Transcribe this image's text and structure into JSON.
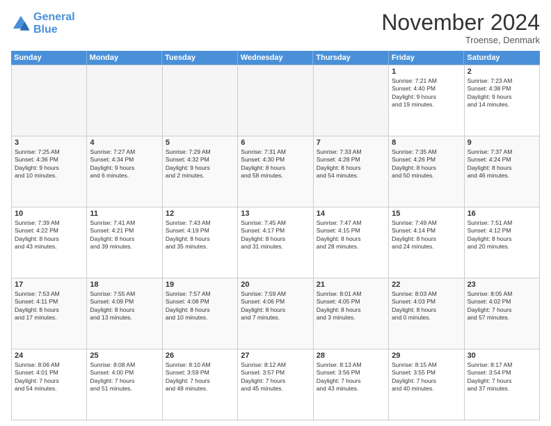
{
  "logo": {
    "line1": "General",
    "line2": "Blue"
  },
  "title": "November 2024",
  "location": "Troense, Denmark",
  "header": {
    "days": [
      "Sunday",
      "Monday",
      "Tuesday",
      "Wednesday",
      "Thursday",
      "Friday",
      "Saturday"
    ]
  },
  "weeks": [
    [
      {
        "day": "",
        "info": ""
      },
      {
        "day": "",
        "info": ""
      },
      {
        "day": "",
        "info": ""
      },
      {
        "day": "",
        "info": ""
      },
      {
        "day": "",
        "info": ""
      },
      {
        "day": "1",
        "info": "Sunrise: 7:21 AM\nSunset: 4:40 PM\nDaylight: 9 hours\nand 19 minutes."
      },
      {
        "day": "2",
        "info": "Sunrise: 7:23 AM\nSunset: 4:38 PM\nDaylight: 9 hours\nand 14 minutes."
      }
    ],
    [
      {
        "day": "3",
        "info": "Sunrise: 7:25 AM\nSunset: 4:36 PM\nDaylight: 9 hours\nand 10 minutes."
      },
      {
        "day": "4",
        "info": "Sunrise: 7:27 AM\nSunset: 4:34 PM\nDaylight: 9 hours\nand 6 minutes."
      },
      {
        "day": "5",
        "info": "Sunrise: 7:29 AM\nSunset: 4:32 PM\nDaylight: 9 hours\nand 2 minutes."
      },
      {
        "day": "6",
        "info": "Sunrise: 7:31 AM\nSunset: 4:30 PM\nDaylight: 8 hours\nand 58 minutes."
      },
      {
        "day": "7",
        "info": "Sunrise: 7:33 AM\nSunset: 4:28 PM\nDaylight: 8 hours\nand 54 minutes."
      },
      {
        "day": "8",
        "info": "Sunrise: 7:35 AM\nSunset: 4:26 PM\nDaylight: 8 hours\nand 50 minutes."
      },
      {
        "day": "9",
        "info": "Sunrise: 7:37 AM\nSunset: 4:24 PM\nDaylight: 8 hours\nand 46 minutes."
      }
    ],
    [
      {
        "day": "10",
        "info": "Sunrise: 7:39 AM\nSunset: 4:22 PM\nDaylight: 8 hours\nand 43 minutes."
      },
      {
        "day": "11",
        "info": "Sunrise: 7:41 AM\nSunset: 4:21 PM\nDaylight: 8 hours\nand 39 minutes."
      },
      {
        "day": "12",
        "info": "Sunrise: 7:43 AM\nSunset: 4:19 PM\nDaylight: 8 hours\nand 35 minutes."
      },
      {
        "day": "13",
        "info": "Sunrise: 7:45 AM\nSunset: 4:17 PM\nDaylight: 8 hours\nand 31 minutes."
      },
      {
        "day": "14",
        "info": "Sunrise: 7:47 AM\nSunset: 4:15 PM\nDaylight: 8 hours\nand 28 minutes."
      },
      {
        "day": "15",
        "info": "Sunrise: 7:49 AM\nSunset: 4:14 PM\nDaylight: 8 hours\nand 24 minutes."
      },
      {
        "day": "16",
        "info": "Sunrise: 7:51 AM\nSunset: 4:12 PM\nDaylight: 8 hours\nand 20 minutes."
      }
    ],
    [
      {
        "day": "17",
        "info": "Sunrise: 7:53 AM\nSunset: 4:11 PM\nDaylight: 8 hours\nand 17 minutes."
      },
      {
        "day": "18",
        "info": "Sunrise: 7:55 AM\nSunset: 4:09 PM\nDaylight: 8 hours\nand 13 minutes."
      },
      {
        "day": "19",
        "info": "Sunrise: 7:57 AM\nSunset: 4:08 PM\nDaylight: 8 hours\nand 10 minutes."
      },
      {
        "day": "20",
        "info": "Sunrise: 7:59 AM\nSunset: 4:06 PM\nDaylight: 8 hours\nand 7 minutes."
      },
      {
        "day": "21",
        "info": "Sunrise: 8:01 AM\nSunset: 4:05 PM\nDaylight: 8 hours\nand 3 minutes."
      },
      {
        "day": "22",
        "info": "Sunrise: 8:03 AM\nSunset: 4:03 PM\nDaylight: 8 hours\nand 0 minutes."
      },
      {
        "day": "23",
        "info": "Sunrise: 8:05 AM\nSunset: 4:02 PM\nDaylight: 7 hours\nand 57 minutes."
      }
    ],
    [
      {
        "day": "24",
        "info": "Sunrise: 8:06 AM\nSunset: 4:01 PM\nDaylight: 7 hours\nand 54 minutes."
      },
      {
        "day": "25",
        "info": "Sunrise: 8:08 AM\nSunset: 4:00 PM\nDaylight: 7 hours\nand 51 minutes."
      },
      {
        "day": "26",
        "info": "Sunrise: 8:10 AM\nSunset: 3:59 PM\nDaylight: 7 hours\nand 48 minutes."
      },
      {
        "day": "27",
        "info": "Sunrise: 8:12 AM\nSunset: 3:57 PM\nDaylight: 7 hours\nand 45 minutes."
      },
      {
        "day": "28",
        "info": "Sunrise: 8:13 AM\nSunset: 3:56 PM\nDaylight: 7 hours\nand 43 minutes."
      },
      {
        "day": "29",
        "info": "Sunrise: 8:15 AM\nSunset: 3:55 PM\nDaylight: 7 hours\nand 40 minutes."
      },
      {
        "day": "30",
        "info": "Sunrise: 8:17 AM\nSunset: 3:54 PM\nDaylight: 7 hours\nand 37 minutes."
      }
    ]
  ]
}
